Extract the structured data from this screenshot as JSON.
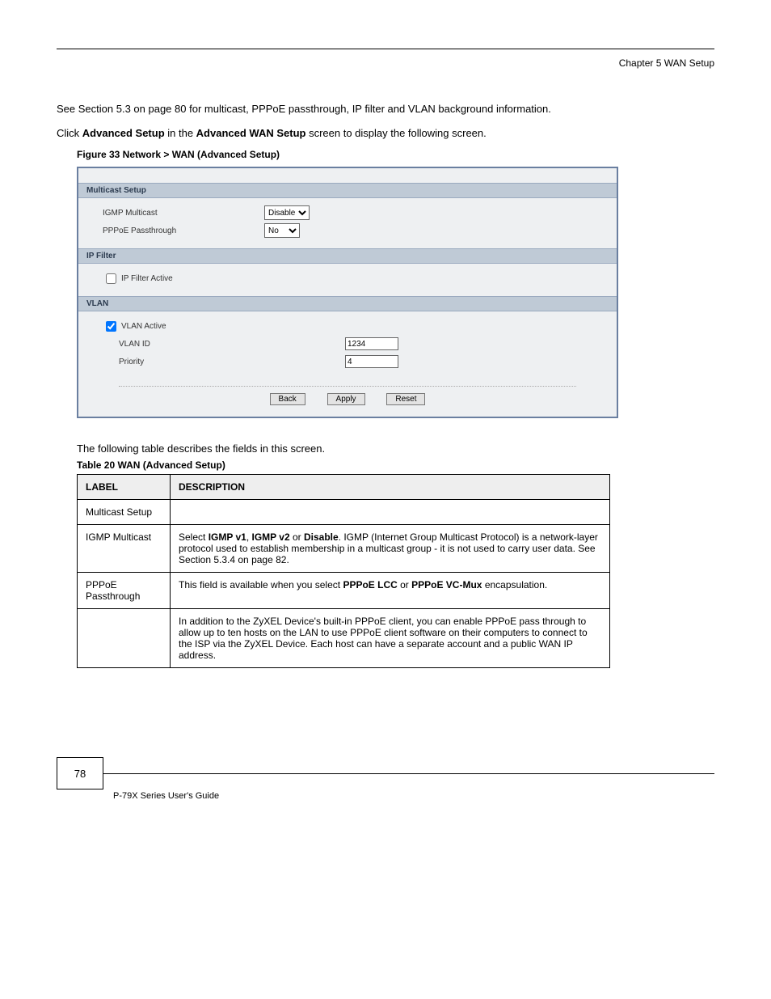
{
  "header": {
    "chapter": "Chapter 5 WAN Setup"
  },
  "intro": {
    "p1_prefix": "See ",
    "p1_link": "Section 5.3 on page 80",
    "p1_suffix": " for multicast, PPPoE passthrough, IP filter and VLAN background information.",
    "p2_a": "Click ",
    "p2_b": "Advanced Setup",
    "p2_c": " in the ",
    "p2_d": "Advanced WAN Setup",
    "p2_e": " screen to display the following screen."
  },
  "figure_caption": "Figure 33   Network > WAN (Advanced Setup)",
  "panel": {
    "section1_title": "Multicast Setup",
    "igmp_label": "IGMP Multicast",
    "igmp_value": "Disable",
    "pppoe_label": "PPPoE Passthrough",
    "pppoe_value": "No",
    "section2_title": "IP Filter",
    "ipfilter_label": "IP Filter Active",
    "section3_title": "VLAN",
    "vlan_active_label": "VLAN Active",
    "vlan_id_label": "VLAN ID",
    "vlan_id_value": "1234",
    "priority_label": "Priority",
    "priority_value": "4",
    "btn_back": "Back",
    "btn_apply": "Apply",
    "btn_reset": "Reset"
  },
  "table_intro": "The following table describes the fields in this screen.",
  "table_caption": "Table 20   WAN (Advanced Setup)",
  "table": {
    "h1": "LABEL",
    "h2": "DESCRIPTION",
    "rows": [
      {
        "label": "Multicast Setup",
        "desc": ""
      },
      {
        "label": "IGMP Multicast",
        "desc_a": "Select ",
        "desc_b": "IGMP v1",
        "desc_c": ", ",
        "desc_d": "IGMP v2",
        "desc_e": " or ",
        "desc_f": "Disable",
        "desc_g": ". IGMP (Internet Group Multicast Protocol) is a network-layer protocol used to establish membership in a multicast group - it is not used to carry user data. See ",
        "desc_link": "Section 5.3.4 on page 82",
        "desc_h": "."
      },
      {
        "label": "PPPoE Passthrough",
        "desc_a": "This field is available when you select ",
        "desc_b": "PPPoE LCC",
        "desc_c": " or ",
        "desc_d": "PPPoE VC-Mux",
        "desc_e": " encapsulation."
      },
      {
        "label": "",
        "desc": "In addition to the ZyXEL Device's built-in PPPoE client, you can enable PPPoE pass through to allow up to ten hosts on the LAN to use PPPoE client software on their computers to connect to the ISP via the ZyXEL Device. Each host can have a separate account and a public WAN IP address."
      }
    ]
  },
  "footer": {
    "page": "78",
    "text": "P-79X Series User's Guide"
  }
}
